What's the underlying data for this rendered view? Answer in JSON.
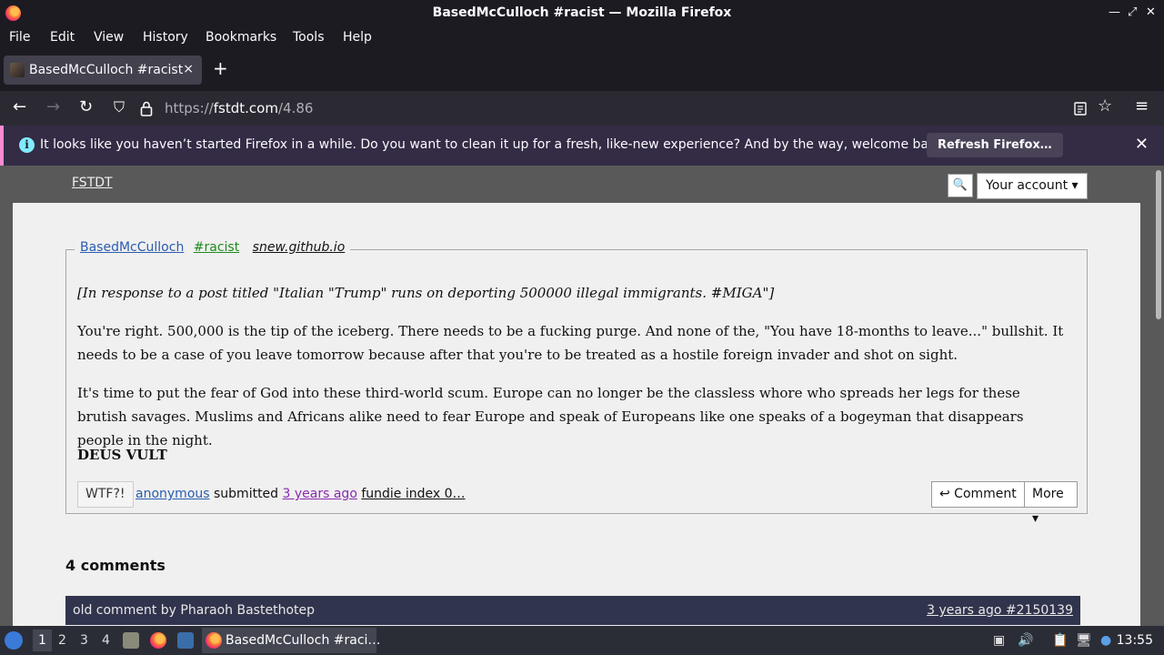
{
  "window": {
    "title": "BasedMcCulloch #racist — Mozilla Firefox"
  },
  "menu": [
    "File",
    "Edit",
    "View",
    "History",
    "Bookmarks",
    "Tools",
    "Help"
  ],
  "tab": {
    "title": "BasedMcCulloch #racist",
    "close": "×",
    "new_tab": "+"
  },
  "url": {
    "prefix": "https://",
    "host": "fstdt.com",
    "path": "/4.86"
  },
  "notification": {
    "message": "It looks like you haven’t started Firefox in a while. Do you want to clean it up for a fresh, like-new experience? And by the way, welcome back!",
    "button": "Refresh Firefox…",
    "info_icon": "i"
  },
  "site": {
    "logo": "FSTDT",
    "search_icon": "🔍",
    "account_button": "Your account ▾"
  },
  "post": {
    "author": "BasedMcCulloch",
    "tag": "#racist",
    "source": "snew.github.io",
    "paragraphs": [
      "[In response to a post titled \"Italian \"Trump\" runs on deporting 500000 illegal immigrants. #MIGA\"]",
      "You're right. 500,000 is the tip of the iceberg. There needs to be a fucking purge. And none of the, \"You have 18-months to leave...\" bullshit. It needs to be a case of you leave tomorrow because after that you're to be treated as a hostile foreign invader and shot on sight.",
      "It's time to put the fear of God into these third-world scum. Europe can no longer be the classless whore who spreads her legs for these brutish savages. Muslims and Africans alike need to fear Europe and speak of Europeans like one speaks of a bogeyman that disappears people in the night.",
      "DEUS VULT"
    ],
    "wtf_button": "WTF?!",
    "submitter": "anonymous",
    "submitted_word": " submitted ",
    "age": "3 years ago",
    "index": "fundie index 0…",
    "comment_button": "↩ Comment",
    "more_button": "More ▾"
  },
  "comments": {
    "heading": "4 comments",
    "first": {
      "by": "old comment by Pharaoh Bastethotep",
      "meta": "3 years ago #2150139"
    }
  },
  "taskbar": {
    "workspaces": [
      "1",
      "2",
      "3",
      "4"
    ],
    "task_title": "BasedMcCulloch #raci…",
    "clock": "13:55"
  }
}
